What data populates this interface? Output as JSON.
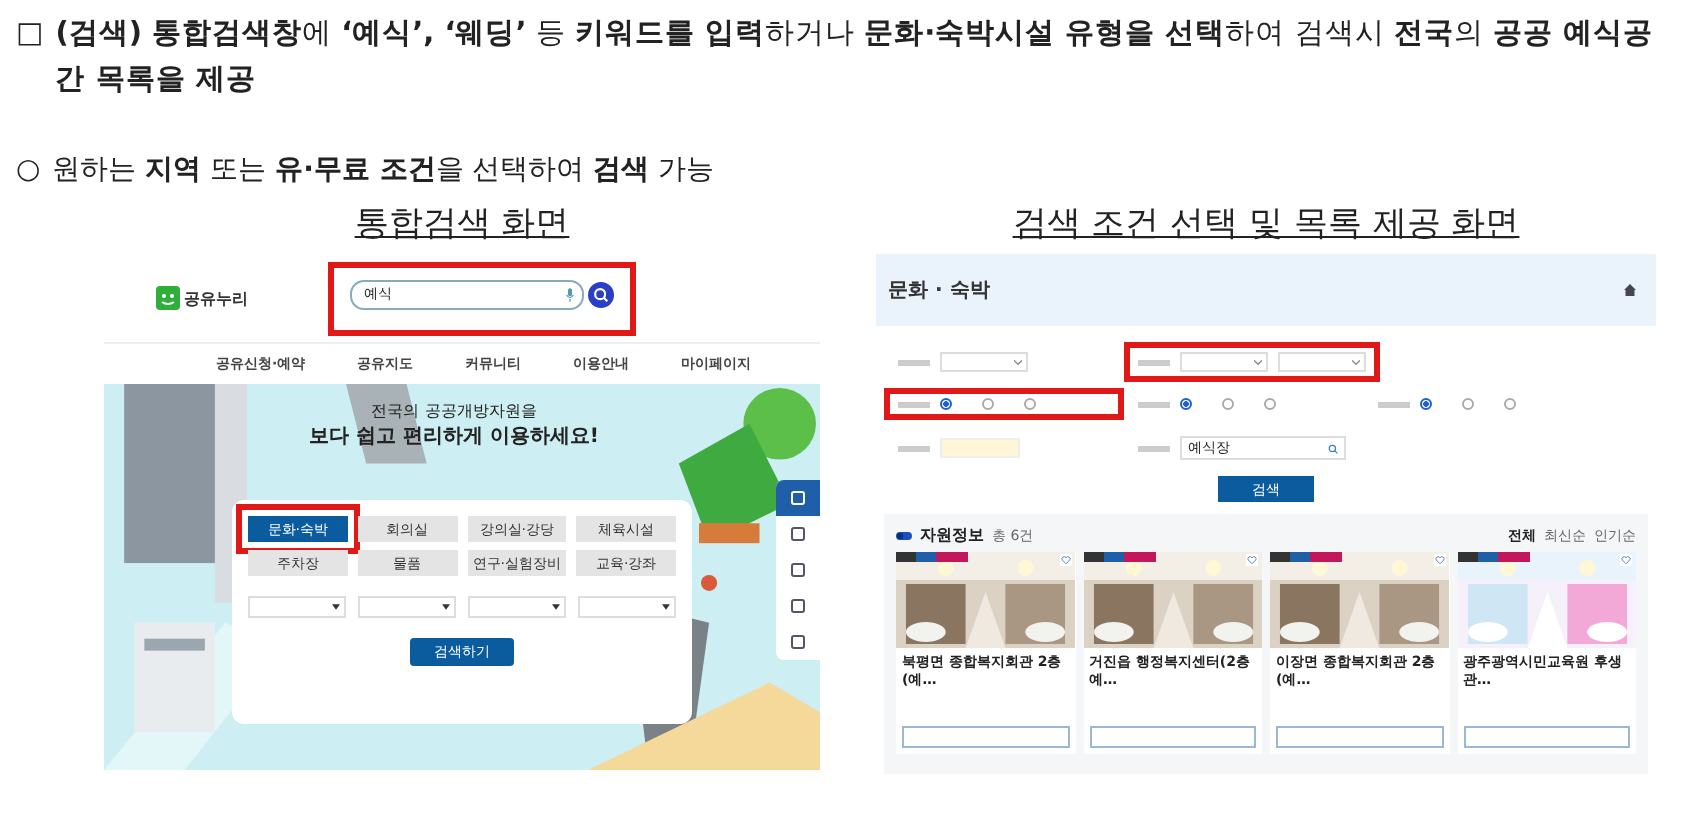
{
  "statement": {
    "bullet": "□",
    "text": "**(검색) 통합검색창**에 **‘예식’, ‘웨딩’** 등 **키워드를 입력**하거나 **문화·숙박시설 유형을 선택**하여 검색시 **전국**의 **공공 예식공간 목록을 제공**"
  },
  "point": {
    "bullet": "○",
    "text": "원하는 **지역** 또는 **유·무료 조건**을 선택하여 **검색** 가능"
  },
  "left_screen": {
    "caption": "통합검색 화면",
    "logo": "공유누리",
    "search": {
      "value": "예식",
      "highlighted": true
    },
    "nav": [
      "공유신청·예약",
      "공유지도",
      "커뮤니티",
      "이용안내",
      "마이페이지"
    ],
    "headline": [
      "전국의 공공개방자원을",
      "보다 쉽고 편리하게 이용하세요!"
    ],
    "categories": [
      {
        "label": "문화·숙박",
        "selected": true,
        "highlighted": true
      },
      {
        "label": "회의실",
        "selected": false,
        "highlighted": false
      },
      {
        "label": "강의실·강당",
        "selected": false,
        "highlighted": false
      },
      {
        "label": "체육시설",
        "selected": false,
        "highlighted": false
      },
      {
        "label": "주차장",
        "selected": false,
        "highlighted": false
      },
      {
        "label": "물품",
        "selected": false,
        "highlighted": false
      },
      {
        "label": "연구·실험장비",
        "selected": false,
        "highlighted": false
      },
      {
        "label": "교육·강좌",
        "selected": false,
        "highlighted": false
      }
    ],
    "filters": [
      {
        "kind": "dropdown"
      },
      {
        "kind": "dropdown"
      },
      {
        "kind": "dropdown"
      },
      {
        "kind": "dropdown"
      }
    ],
    "search_button": "검색하기",
    "side_menu": [
      {
        "selected": true
      },
      {
        "selected": false
      },
      {
        "selected": false
      },
      {
        "selected": false
      },
      {
        "selected": false
      }
    ]
  },
  "right_screen": {
    "caption": "검색 조건 선택 및 목록 제공 화면",
    "title": "문화 · 숙박",
    "filters": [
      {
        "kind": "select",
        "highlighted": false
      },
      {
        "kind": "select_pair",
        "highlighted": true
      },
      {
        "kind": "radio",
        "options": [
          {
            "selected": true
          },
          {
            "selected": false
          },
          {
            "selected": false
          }
        ],
        "highlighted": true
      },
      {
        "kind": "radio",
        "options": [
          {
            "selected": true
          },
          {
            "selected": false
          },
          {
            "selected": false
          }
        ],
        "highlighted": false
      },
      {
        "kind": "radio",
        "options": [
          {
            "selected": true
          },
          {
            "selected": false
          },
          {
            "selected": false
          }
        ],
        "highlighted": false
      },
      {
        "kind": "date",
        "highlighted": false
      },
      {
        "kind": "text",
        "value": "예식장",
        "highlighted": false
      }
    ],
    "search_button": "검색",
    "results_title": "자원정보",
    "results_count": "총 6건",
    "sort": [
      {
        "label": "전체",
        "selected": true
      },
      {
        "label": "최신순",
        "selected": false
      },
      {
        "label": "인기순",
        "selected": false
      }
    ],
    "cards": [
      {
        "tags": [
          {
            "color": "#333333"
          },
          {
            "color": "#1f5fa8"
          },
          {
            "color": "#c2185b"
          }
        ],
        "title": "북평면 종합복지회관 2층(예…"
      },
      {
        "tags": [
          {
            "color": "#333333"
          },
          {
            "color": "#1f5fa8"
          },
          {
            "color": "#c2185b"
          }
        ],
        "title": "거진읍 행정복지센터(2층 예…"
      },
      {
        "tags": [
          {
            "color": "#333333"
          },
          {
            "color": "#1f5fa8"
          },
          {
            "color": "#c2185b"
          }
        ],
        "title": "이장면 종합복지회관 2층(예…"
      },
      {
        "tags": [
          {
            "color": "#333333"
          },
          {
            "color": "#1f5fa8"
          },
          {
            "color": "#c2185b"
          }
        ],
        "title": "광주광역시민교육원 후생관…"
      }
    ]
  }
}
